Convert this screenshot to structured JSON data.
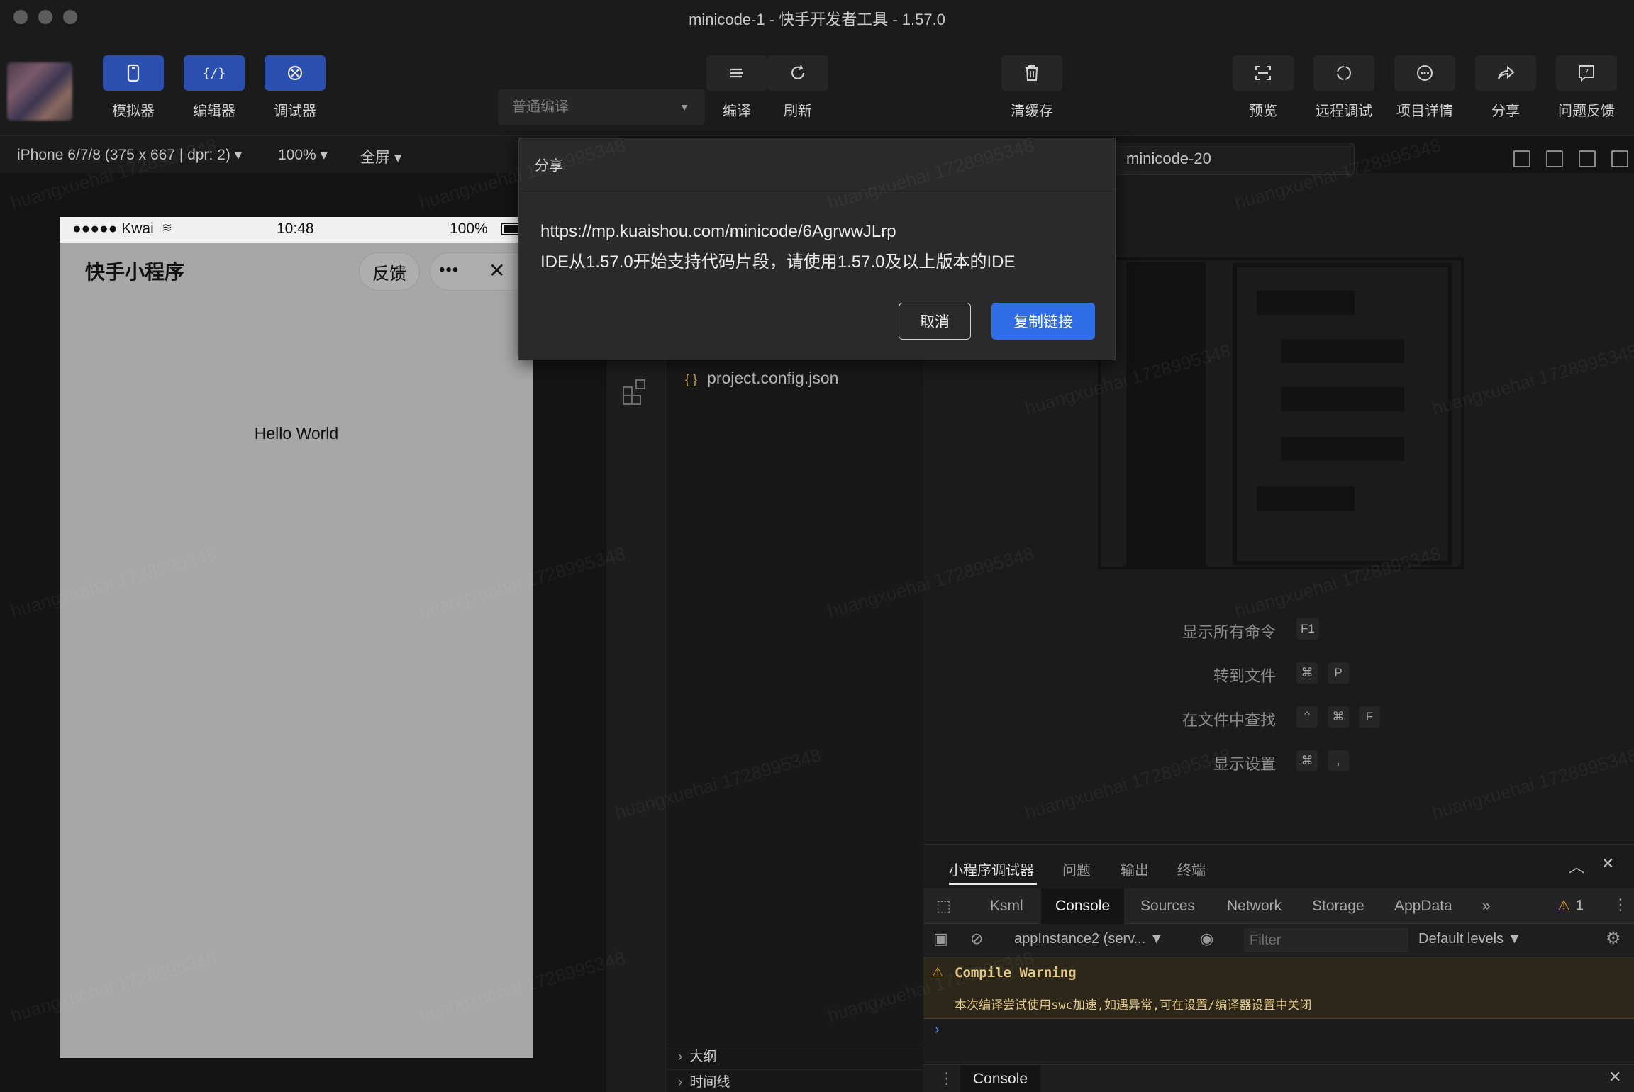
{
  "window": {
    "title": "minicode-1 - 快手开发者工具 - 1.57.0"
  },
  "toolbar": {
    "simulator": "模拟器",
    "editor": "编辑器",
    "debugger": "调试器",
    "compile_mode": "普通编译",
    "compile": "编译",
    "refresh": "刷新",
    "clear_cache": "清缓存",
    "preview": "预览",
    "remote_debug": "远程调试",
    "project_detail": "项目详情",
    "share": "分享",
    "feedback": "问题反馈"
  },
  "devbar": {
    "device": "iPhone 6/7/8 (375 x 667 | dpr: 2)",
    "zoom": "100%",
    "mode": "全屏"
  },
  "phone": {
    "carrier": "●●●●● Kwai",
    "time": "10:48",
    "battery": "100%",
    "nav_title": "快手小程序",
    "feedback_btn": "反馈",
    "content": "Hello World"
  },
  "editor": {
    "tab_name": "minicode-20",
    "file": "project.config.json",
    "outline": "大纲",
    "timeline": "时间线"
  },
  "welcome": {
    "commands": [
      {
        "label": "显示所有命令",
        "keys": [
          "F1"
        ]
      },
      {
        "label": "转到文件",
        "keys": [
          "⌘",
          "P"
        ]
      },
      {
        "label": "在文件中查找",
        "keys": [
          "⇧",
          "⌘",
          "F"
        ]
      },
      {
        "label": "显示设置",
        "keys": [
          "⌘",
          ","
        ]
      }
    ]
  },
  "debugger": {
    "tabs": [
      "小程序调试器",
      "问题",
      "输出",
      "终端"
    ],
    "devtools_tabs": [
      "Ksml",
      "Console",
      "Sources",
      "Network",
      "Storage",
      "AppData"
    ],
    "warning_count": "1",
    "context": "appInstance2 (serv...",
    "filter_placeholder": "Filter",
    "levels": "Default levels",
    "warning_title": "Compile Warning",
    "warning_text": "本次编译尝试使用swc加速,如遇异常,可在设置/编译器设置中关闭",
    "drawer_tab": "Console"
  },
  "modal": {
    "title": "分享",
    "url": "https://mp.kuaishou.com/minicode/6AgrwwJLrp",
    "note": "IDE从1.57.0开始支持代码片段，请使用1.57.0及以上版本的IDE",
    "cancel": "取消",
    "copy": "复制链接"
  },
  "watermark": "huangxuehai 1728995348"
}
